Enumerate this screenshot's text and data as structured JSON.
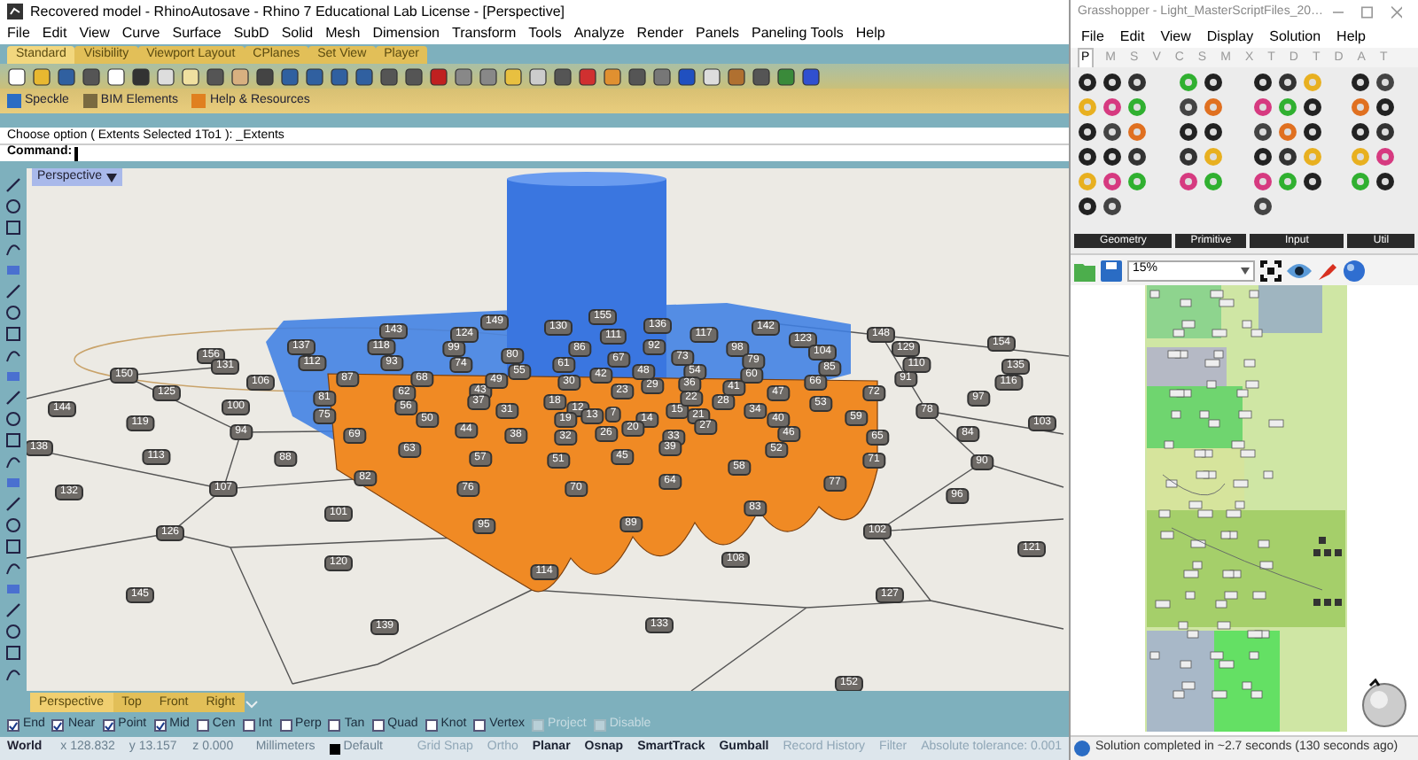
{
  "rhino": {
    "title": "Recovered model - RhinoAutosave - Rhino 7 Educational Lab License - [Perspective]",
    "menu": [
      "File",
      "Edit",
      "View",
      "Curve",
      "Surface",
      "SubD",
      "Solid",
      "Mesh",
      "Dimension",
      "Transform",
      "Tools",
      "Analyze",
      "Render",
      "Panels",
      "Paneling Tools",
      "Help"
    ],
    "toolbar_tabs": [
      {
        "label": "Standard",
        "selected": true
      },
      {
        "label": "Visibility",
        "selected": false
      },
      {
        "label": "Viewport Layout",
        "selected": false
      },
      {
        "label": "CPlanes",
        "selected": false
      },
      {
        "label": "Set View",
        "selected": false
      },
      {
        "label": "Player",
        "selected": false
      }
    ],
    "plugin_toolbar": [
      {
        "label": "Speckle"
      },
      {
        "label": "BIM Elements"
      },
      {
        "label": "Help & Resources"
      }
    ],
    "command_history": "Choose option ( Extents  Selected  1To1 ): _Extents",
    "command_prompt": "Command:",
    "viewport": {
      "title": "Perspective",
      "point_labels": [
        "143",
        "149",
        "130",
        "155",
        "136",
        "142",
        "137",
        "118",
        "99",
        "124",
        "86",
        "111",
        "92",
        "117",
        "98",
        "123",
        "148",
        "129",
        "154",
        "156",
        "112",
        "93",
        "74",
        "80",
        "61",
        "67",
        "73",
        "79",
        "104",
        "110",
        "150",
        "131",
        "87",
        "68",
        "55",
        "42",
        "48",
        "54",
        "60",
        "85",
        "91",
        "135",
        "125",
        "106",
        "62",
        "43",
        "49",
        "30",
        "23",
        "29",
        "36",
        "41",
        "47",
        "66",
        "72",
        "116",
        "144",
        "100",
        "81",
        "56",
        "37",
        "31",
        "18",
        "12",
        "15",
        "22",
        "28",
        "34",
        "53",
        "78",
        "97",
        "119",
        "75",
        "50",
        "19",
        "13",
        "7",
        "14",
        "21",
        "40",
        "59",
        "103",
        "94",
        "69",
        "44",
        "38",
        "32",
        "26",
        "20",
        "33",
        "27",
        "46",
        "65",
        "84",
        "138",
        "113",
        "88",
        "63",
        "57",
        "51",
        "45",
        "39",
        "52",
        "71",
        "90",
        "82",
        "64",
        "58",
        "77",
        "132",
        "107",
        "76",
        "70",
        "96",
        "126",
        "101",
        "95",
        "89",
        "83",
        "102",
        "120",
        "114",
        "108",
        "121",
        "145",
        "127",
        "139",
        "133",
        "152"
      ]
    },
    "viewport_tabs": [
      {
        "label": "Perspective",
        "selected": true
      },
      {
        "label": "Top",
        "selected": false
      },
      {
        "label": "Front",
        "selected": false
      },
      {
        "label": "Right",
        "selected": false
      }
    ],
    "osnaps": [
      {
        "label": "End",
        "checked": true,
        "disabled": false
      },
      {
        "label": "Near",
        "checked": true,
        "disabled": false
      },
      {
        "label": "Point",
        "checked": true,
        "disabled": false
      },
      {
        "label": "Mid",
        "checked": true,
        "disabled": false
      },
      {
        "label": "Cen",
        "checked": false,
        "disabled": false
      },
      {
        "label": "Int",
        "checked": false,
        "disabled": false
      },
      {
        "label": "Perp",
        "checked": false,
        "disabled": false
      },
      {
        "label": "Tan",
        "checked": false,
        "disabled": false
      },
      {
        "label": "Quad",
        "checked": false,
        "disabled": false
      },
      {
        "label": "Knot",
        "checked": false,
        "disabled": false
      },
      {
        "label": "Vertex",
        "checked": false,
        "disabled": false
      },
      {
        "label": "Project",
        "checked": false,
        "disabled": true
      },
      {
        "label": "Disable",
        "checked": false,
        "disabled": true
      }
    ],
    "status_bar": {
      "cplane": "World",
      "x": "x 128.832",
      "y": "y 13.157",
      "z": "z 0.000",
      "units": "Millimeters",
      "layer": "Default",
      "toggles": [
        {
          "label": "Grid Snap",
          "on": false
        },
        {
          "label": "Ortho",
          "on": false
        },
        {
          "label": "Planar",
          "on": true
        },
        {
          "label": "Osnap",
          "on": true
        },
        {
          "label": "SmartTrack",
          "on": true
        },
        {
          "label": "Gumball",
          "on": true
        },
        {
          "label": "Record History",
          "on": false
        }
      ],
      "filter": "Filter",
      "tolerance": "Absolute tolerance: 0.001"
    }
  },
  "grasshopper": {
    "title": "Grasshopper - Light_MasterScriptFiles_20…",
    "menu": [
      "File",
      "Edit",
      "View",
      "Display",
      "Solution",
      "Help"
    ],
    "tabs": [
      {
        "label": "P",
        "selected": true
      },
      {
        "label": "M",
        "selected": false
      },
      {
        "label": "S",
        "selected": false
      },
      {
        "label": "V",
        "selected": false
      },
      {
        "label": "C",
        "selected": false
      },
      {
        "label": "S",
        "selected": false
      },
      {
        "label": "M",
        "selected": false
      },
      {
        "label": "X",
        "selected": false
      },
      {
        "label": "T",
        "selected": false
      },
      {
        "label": "D",
        "selected": false
      },
      {
        "label": "T",
        "selected": false
      },
      {
        "label": "D",
        "selected": false
      },
      {
        "label": "A",
        "selected": false
      },
      {
        "label": "T",
        "selected": false
      }
    ],
    "panel_groups": [
      "Geometry",
      "Primitive",
      "Input",
      "Util"
    ],
    "zoom": "15%",
    "status": "Solution completed in ~2.7 seconds (130 seconds ago)"
  }
}
